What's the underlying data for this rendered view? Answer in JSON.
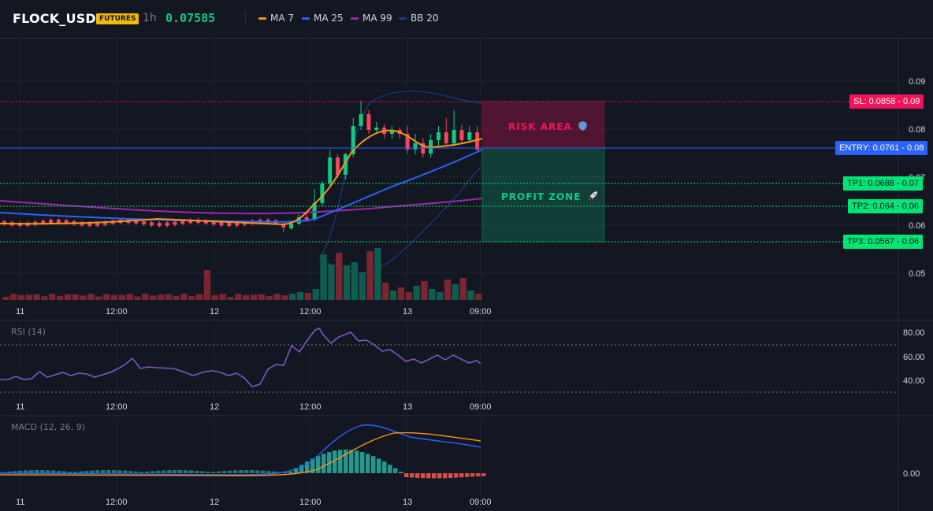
{
  "header": {
    "symbol": "FLOCK_USDT",
    "badge": "FUTURES",
    "interval": "1h",
    "price": "0.07585",
    "legend": [
      {
        "label": "MA 7",
        "color": "#f7931a"
      },
      {
        "label": "MA 25",
        "color": "#2962ff"
      },
      {
        "label": "MA 99",
        "color": "#9c27b0"
      },
      {
        "label": "BB 20",
        "color": "#2962ff"
      }
    ]
  },
  "main": {
    "price_ticks": [
      "0.09",
      "0.08",
      "0.07",
      "0.06",
      "0.05"
    ],
    "time_ticks": [
      "11",
      "12:00",
      "12",
      "12:00",
      "13",
      "09:00"
    ],
    "zones": {
      "risk_label": "RISK AREA",
      "risk_icon": "shield-icon",
      "profit_label": "PROFIT ZONE",
      "profit_icon": "rocket-icon"
    },
    "levels": {
      "sl": "SL: 0.0858 - 0.09",
      "entry": "ENTRY: 0.0761 - 0.08",
      "tp1": "TP1: 0.0688 - 0.07",
      "tp2": "TP2: 0.064 - 0.06",
      "tp3": "TP3: 0.0567 - 0.06"
    },
    "colors": {
      "up": "#0ecb81",
      "down": "#f6465d",
      "sl": "#f0145a",
      "entry": "#2962ff",
      "tp": "#00e676"
    }
  },
  "rsi": {
    "title": "RSI (14)",
    "ticks": [
      "80.00",
      "60.00",
      "40.00"
    ],
    "time_ticks": [
      "11",
      "12:00",
      "12",
      "12:00",
      "13",
      "09:00"
    ]
  },
  "macd": {
    "title": "MACD (12, 26, 9)",
    "ticks": [
      "0.00"
    ],
    "time_ticks": [
      "11",
      "12:00",
      "12",
      "12:00",
      "13",
      "09:00"
    ]
  }
}
